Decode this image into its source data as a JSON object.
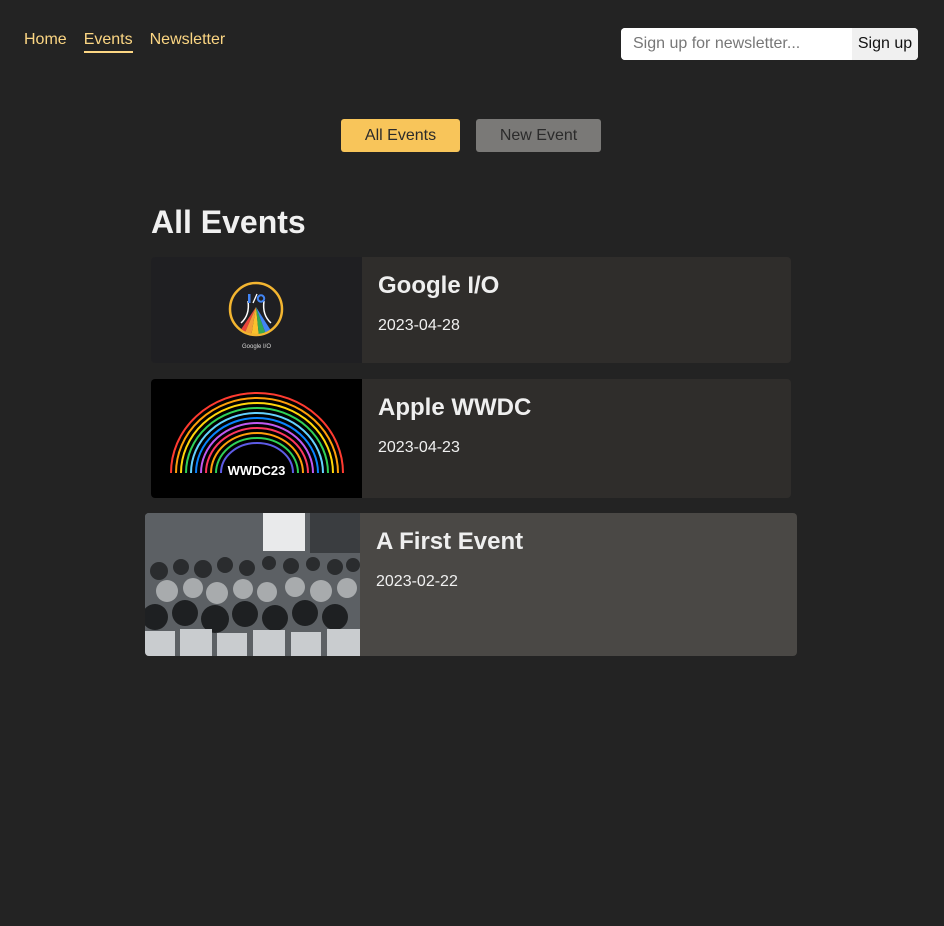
{
  "nav": {
    "items": [
      {
        "label": "Home"
      },
      {
        "label": "Events"
      },
      {
        "label": "Newsletter"
      }
    ]
  },
  "newsletter": {
    "placeholder": "Sign up for newsletter...",
    "button_label": "Sign up"
  },
  "subnav": {
    "all_events_label": "All Events",
    "new_event_label": "New Event"
  },
  "page": {
    "title": "All Events"
  },
  "events": [
    {
      "title": "Google I/O",
      "date": "2023-04-28",
      "image_caption": "Google I/O"
    },
    {
      "title": "Apple WWDC",
      "date": "2023-04-23",
      "image_caption": "WWDC23"
    },
    {
      "title": "A First Event",
      "date": "2023-02-22"
    }
  ],
  "colors": {
    "background": "#232323",
    "accent": "#fcd683",
    "primary_button": "#f8c55a",
    "secondary_button": "#7a7977",
    "card": "#2f2d2b",
    "card_highlight": "#4a4845"
  }
}
